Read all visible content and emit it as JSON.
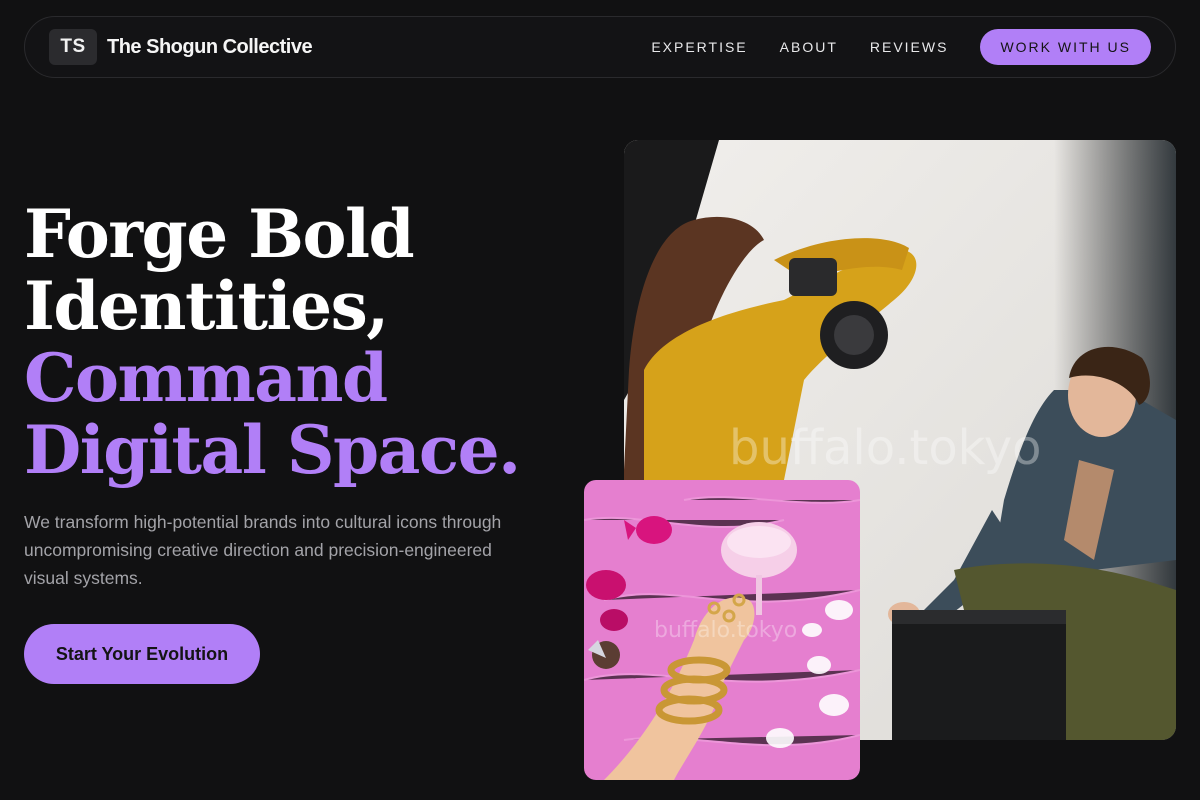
{
  "nav": {
    "logo_initials": "TS",
    "brand_name": "The Shogun Collective",
    "links": [
      "EXPERTISE",
      "ABOUT",
      "REVIEWS"
    ],
    "cta_label": "WORK WITH US"
  },
  "hero": {
    "headline_lines": [
      "Forge Bold",
      "Identities,",
      "Command",
      "Digital Space."
    ],
    "subtext": "We transform high-potential brands into cultural icons through uncompromising creative direction and precision-engineered visual systems.",
    "cta_label": "Start Your Evolution"
  },
  "images": {
    "main_watermark": "buffalo.tokyo",
    "small_watermark": "buffalo.tokyo"
  },
  "colors": {
    "accent": "#b17ff7",
    "background": "#111112"
  }
}
